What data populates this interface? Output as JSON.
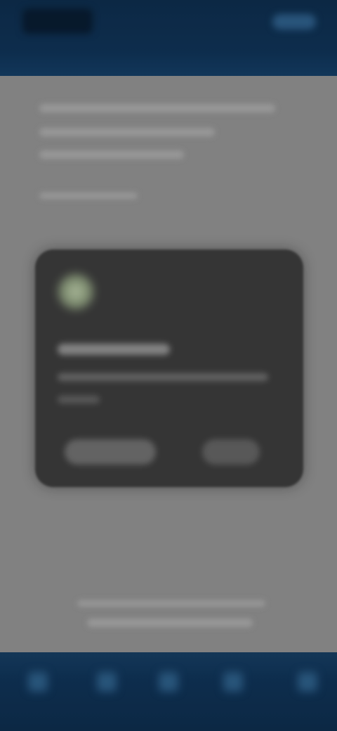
{
  "header": {
    "logo": "brand-logo",
    "action": "top-action"
  },
  "dialog": {
    "icon": "app-icon"
  },
  "bottom_nav": {
    "items": [
      "nav-item-1",
      "nav-item-2",
      "nav-item-3",
      "nav-item-4",
      "nav-item-5"
    ]
  },
  "colors": {
    "header_bg": "#0d2f52",
    "content_bg": "#8a8a8a",
    "dialog_bg": "#383838",
    "nav_bg": "#0b2a48"
  }
}
